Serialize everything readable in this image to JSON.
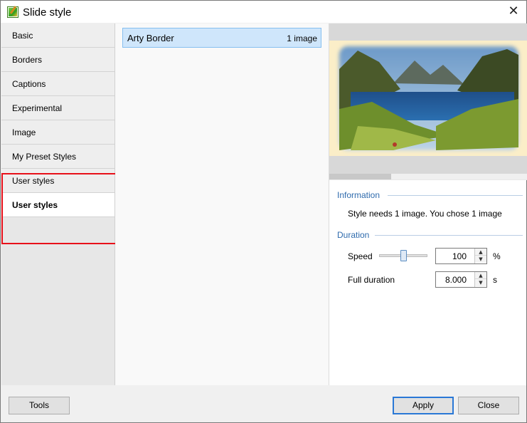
{
  "window": {
    "title": "Slide style"
  },
  "sidebar": {
    "items": [
      {
        "label": "Basic"
      },
      {
        "label": "Borders"
      },
      {
        "label": "Captions"
      },
      {
        "label": "Experimental"
      },
      {
        "label": "Image"
      },
      {
        "label": "My Preset Styles"
      },
      {
        "label": "User styles"
      },
      {
        "label": "User styles",
        "selected": true
      }
    ]
  },
  "styles": {
    "items": [
      {
        "name": "Arty Border",
        "count": "1 image",
        "selected": true
      }
    ]
  },
  "information": {
    "heading": "Information",
    "text": "Style needs 1 image. You chose 1 image"
  },
  "duration": {
    "heading": "Duration",
    "speed_label": "Speed",
    "speed_value": "100",
    "speed_unit": "%",
    "speed_slider_fraction": 0.5,
    "full_duration_label": "Full duration",
    "full_duration_value": "8.000",
    "full_duration_unit": "s"
  },
  "buttons": {
    "tools": "Tools",
    "apply": "Apply",
    "close": "Close"
  },
  "colors": {
    "accent": "#2a78d6",
    "section_heading": "#2f6bad",
    "selected_item": "#cfe6fb",
    "highlight_box": "#e8101a"
  },
  "icons": {
    "app": "slide-style-app-icon",
    "close": "close-icon",
    "spin_up": "spin-up-icon",
    "spin_down": "spin-down-icon"
  }
}
